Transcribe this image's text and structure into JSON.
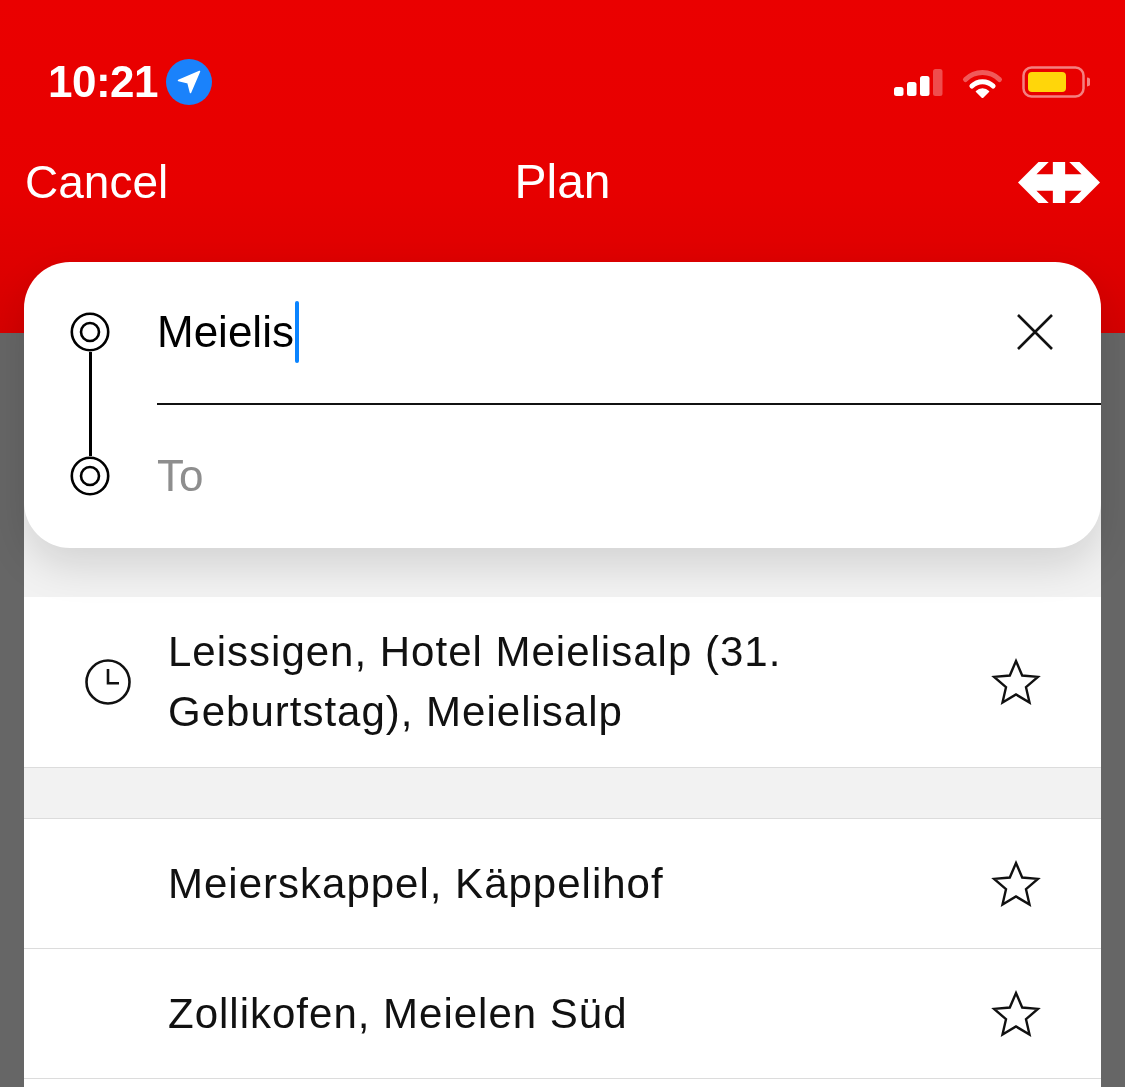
{
  "status_bar": {
    "time": "10:21"
  },
  "nav": {
    "cancel": "Cancel",
    "title": "Plan"
  },
  "route": {
    "from": {
      "value": "Meielis",
      "focused": true
    },
    "to": {
      "placeholder": "To",
      "focused": false
    }
  },
  "sections": [
    {
      "items": [
        {
          "kind": "recent",
          "label": "Leissigen, Hotel Meielisalp (31. Geburtstag), Meielisalp",
          "favorite": false
        }
      ]
    },
    {
      "items": [
        {
          "kind": "stop",
          "label": "Meierskappel, Käppelihof",
          "favorite": false
        },
        {
          "kind": "stop",
          "label": "Zollikofen, Meielen Süd",
          "favorite": false
        }
      ]
    }
  ]
}
